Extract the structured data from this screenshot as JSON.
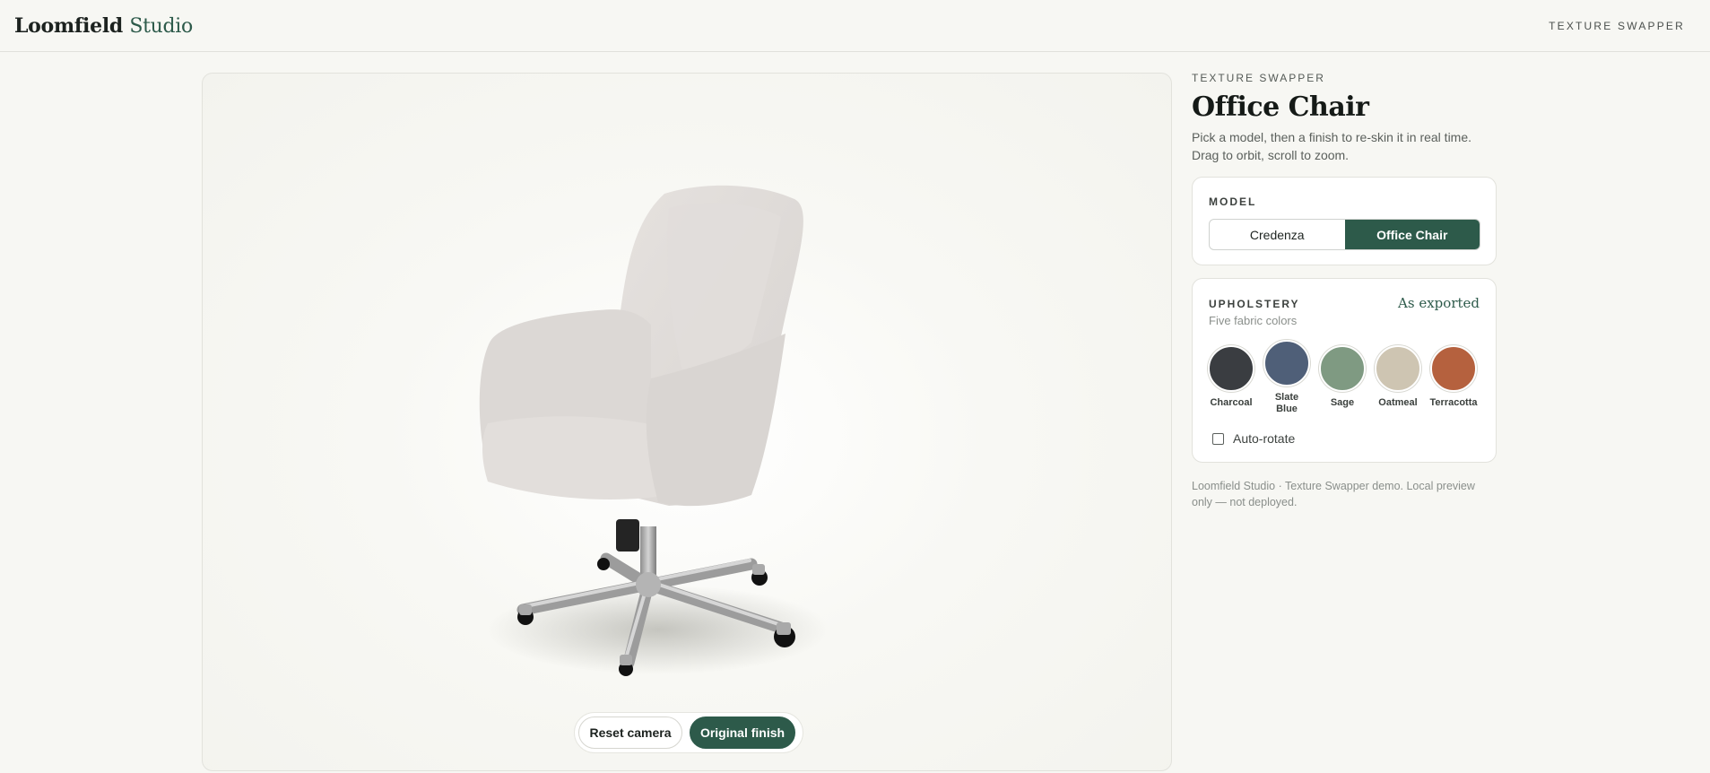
{
  "header": {
    "brand_primary": "Loomfield",
    "brand_secondary": "Studio",
    "nav_label": "TEXTURE SWAPPER"
  },
  "viewer": {
    "reset_label": "Reset camera",
    "original_label": "Original finish"
  },
  "panel": {
    "eyebrow": "TEXTURE SWAPPER",
    "title": "Office Chair",
    "description": "Pick a model, then a finish to re-skin it in real time. Drag to orbit, scroll to zoom."
  },
  "model": {
    "label": "MODEL",
    "options": [
      "Credenza",
      "Office Chair"
    ],
    "selected": "Office Chair"
  },
  "upholstery": {
    "label": "UPHOLSTERY",
    "status": "As exported",
    "subtitle": "Five fabric colors",
    "swatches": [
      {
        "name": "Charcoal",
        "color": "#3a3d41"
      },
      {
        "name": "Slate Blue",
        "color": "#4f5f78"
      },
      {
        "name": "Sage",
        "color": "#7f9a82"
      },
      {
        "name": "Oatmeal",
        "color": "#cec5b2"
      },
      {
        "name": "Terracotta",
        "color": "#b5613e"
      }
    ],
    "autorotate_label": "Auto-rotate",
    "autorotate_checked": false
  },
  "footnote": "Loomfield Studio · Texture Swapper demo. Local preview only — not deployed.",
  "colors": {
    "accent": "#2d5a4a",
    "background": "#f7f7f3",
    "chair_fabric": "#dedad7",
    "chair_metal": "#a7a7a7"
  }
}
